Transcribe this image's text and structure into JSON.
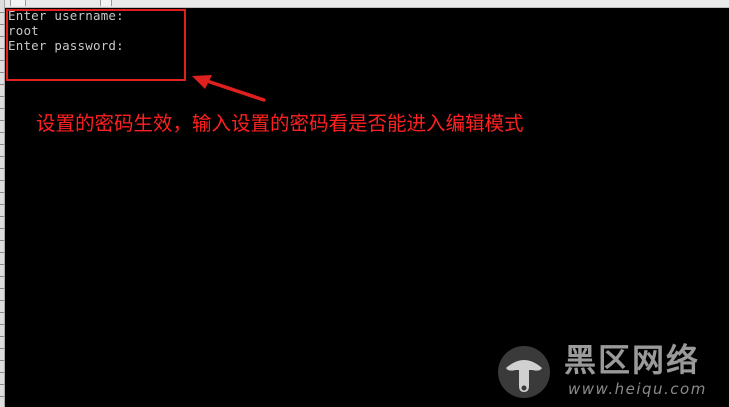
{
  "terminal": {
    "lines": [
      "Enter username:",
      "root",
      "Enter password:"
    ]
  },
  "annotation": {
    "text": "设置的密码生效，输入设置的密码看是否能进入编辑模式",
    "color": "#ff2020"
  },
  "watermark": {
    "title": "黑区网络",
    "url": "www.heiqu.com"
  },
  "colors": {
    "background": "#000000",
    "terminal_text": "#c8c8c8",
    "highlight": "#e0201e"
  }
}
